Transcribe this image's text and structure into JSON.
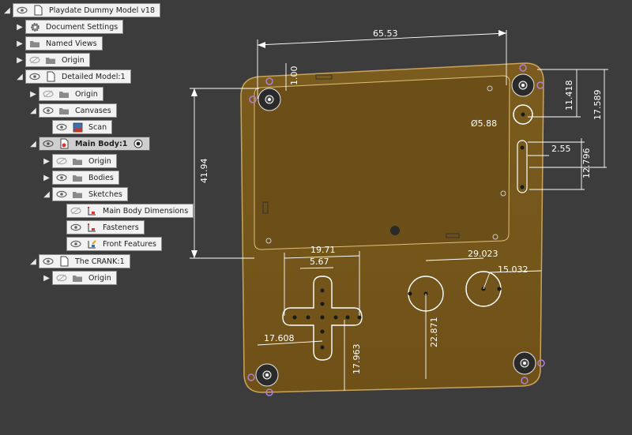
{
  "browser": {
    "root": {
      "label": "Playdate Dummy Model v18"
    },
    "document_settings": {
      "label": "Document Settings"
    },
    "named_views": {
      "label": "Named Views"
    },
    "origin_root": {
      "label": "Origin"
    },
    "detailed_model": {
      "label": "Detailed Model:1"
    },
    "origin_dm": {
      "label": "Origin"
    },
    "canvases": {
      "label": "Canvases"
    },
    "scan": {
      "label": "Scan"
    },
    "main_body": {
      "label": "Main Body:1"
    },
    "origin_mb": {
      "label": "Origin"
    },
    "bodies": {
      "label": "Bodies"
    },
    "sketches": {
      "label": "Sketches"
    },
    "sketch_dims": {
      "label": "Main Body Dimensions"
    },
    "sketch_fasteners": {
      "label": "Fasteners"
    },
    "sketch_front": {
      "label": "Front Features"
    },
    "crank": {
      "label": "The CRANK:1"
    },
    "origin_crank": {
      "label": "Origin"
    }
  },
  "dimensions": {
    "overall_width": "65.53",
    "top_margin": "1.00",
    "screen_height": "41.94",
    "right_top": "11.418",
    "right_total": "17.589",
    "crank_hole_dia": "Ø5.88",
    "crank_offset": "2.55",
    "crank_slot": "12.796",
    "dpad_width": "19.71",
    "dpad_arm": "5.67",
    "dpad_x": "17.608",
    "dpad_y": "17.963",
    "buttons_spacing": "29.023",
    "buttons_diag": "15.032",
    "buttons_y": "22.871"
  },
  "colors": {
    "background": "#3c3c3c",
    "board": "#7a5a1c",
    "panel": "#f2f2f2"
  }
}
